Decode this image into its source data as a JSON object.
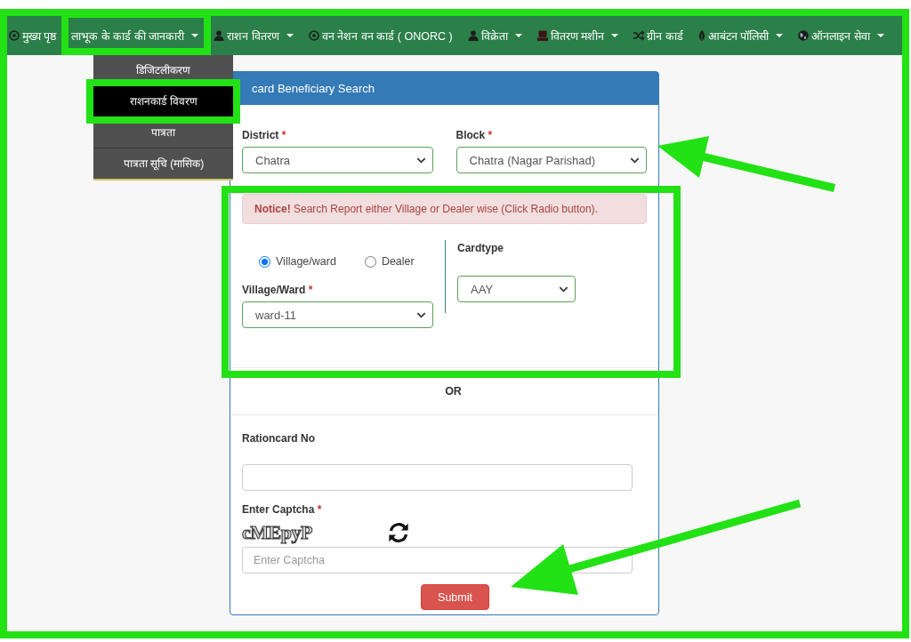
{
  "page": {
    "framed": true
  },
  "nav": {
    "items": [
      {
        "label": "मुख्य पृष्ठ",
        "dropdown": false,
        "highlighted": false,
        "expanded": false
      },
      {
        "label": "लाभूक के कार्ड की जानकारी",
        "dropdown": true,
        "highlighted": true,
        "expanded": true,
        "menu": [
          {
            "label": "डिजिटलीकरण",
            "selected": false,
            "highlighted": false
          },
          {
            "label": "राशनकार्ड विवरण",
            "selected": true,
            "highlighted": true
          },
          {
            "label": "पात्रता",
            "selected": false,
            "highlighted": false
          },
          {
            "label": "पात्रता सूचि (मासिक)",
            "selected": false,
            "highlighted": false
          }
        ]
      },
      {
        "label": "राशन वितरण",
        "dropdown": true,
        "highlighted": false,
        "expanded": false
      },
      {
        "label": "वन नेशन वन कार्ड ( ONORC )",
        "dropdown": false,
        "highlighted": false,
        "expanded": false
      },
      {
        "label": "विक्रेता",
        "dropdown": true,
        "highlighted": false,
        "expanded": false
      },
      {
        "label": "वितरण मशीन",
        "dropdown": true,
        "highlighted": false,
        "expanded": false
      },
      {
        "label": "ग्रीन कार्ड",
        "dropdown": false,
        "highlighted": false,
        "expanded": false
      },
      {
        "label": "आबंटन पॉलिसी",
        "dropdown": true,
        "highlighted": false,
        "expanded": false
      },
      {
        "label": "ऑनलाइन सेवा",
        "dropdown": true,
        "highlighted": false,
        "expanded": false
      }
    ]
  },
  "panel": {
    "title": "card Beneficiary Search",
    "district": {
      "label": "District",
      "required_mark": "*",
      "value": "Chatra",
      "arrow": false
    },
    "block": {
      "label": "Block",
      "required_mark": "*",
      "value": "Chatra (Nagar Parishad)",
      "arrow": true
    },
    "search_section": {
      "highlighted": true,
      "notice": "**Notice!** Search Report either Village or Dealer wise (Click Radio button).",
      "search_by": [
        {
          "label": "Village/ward",
          "selected": true
        },
        {
          "label": "Dealer",
          "selected": false
        }
      ],
      "village_ward": {
        "label": "Village/Ward",
        "required_mark": "*",
        "value": "ward-11"
      },
      "cardtype": {
        "label": "Cardtype",
        "value": "AAY"
      }
    },
    "separator": "OR",
    "rationcard_no": {
      "label": "Rationcard No"
    },
    "captcha": {
      "label": "Enter Captcha",
      "required_mark": "*",
      "code": "cMEpyP",
      "placeholder": "Enter Captcha"
    },
    "submit": {
      "label": "Submit",
      "arrow": true
    }
  }
}
